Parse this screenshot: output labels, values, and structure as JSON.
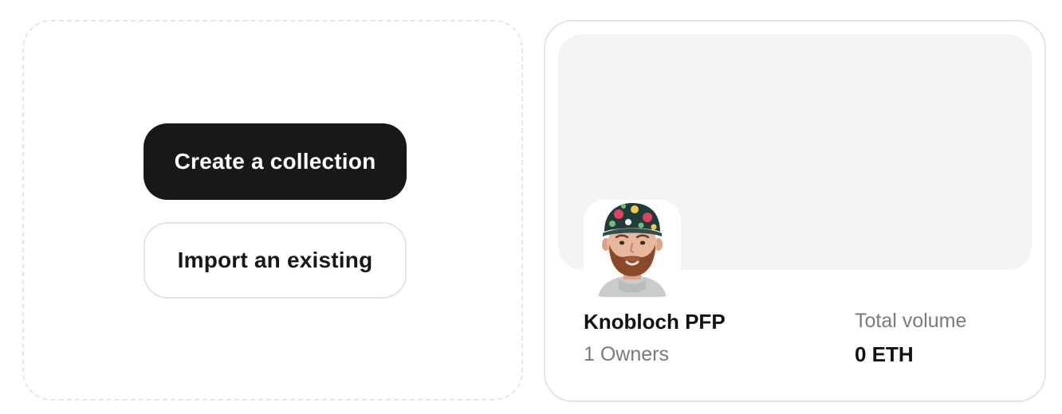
{
  "create_panel": {
    "create_button_label": "Create a collection",
    "import_button_label": "Import an existing"
  },
  "collection": {
    "name": "Knobloch PFP",
    "owners": "1 Owners",
    "volume_label": "Total volume",
    "volume_value": "0 ETH",
    "avatar_icon": "bearded-man-with-floral-cap-avatar"
  },
  "colors": {
    "primary_button_bg": "#18181b",
    "banner_bg": "#f4f4f4",
    "muted_text": "#7a7a7a"
  }
}
